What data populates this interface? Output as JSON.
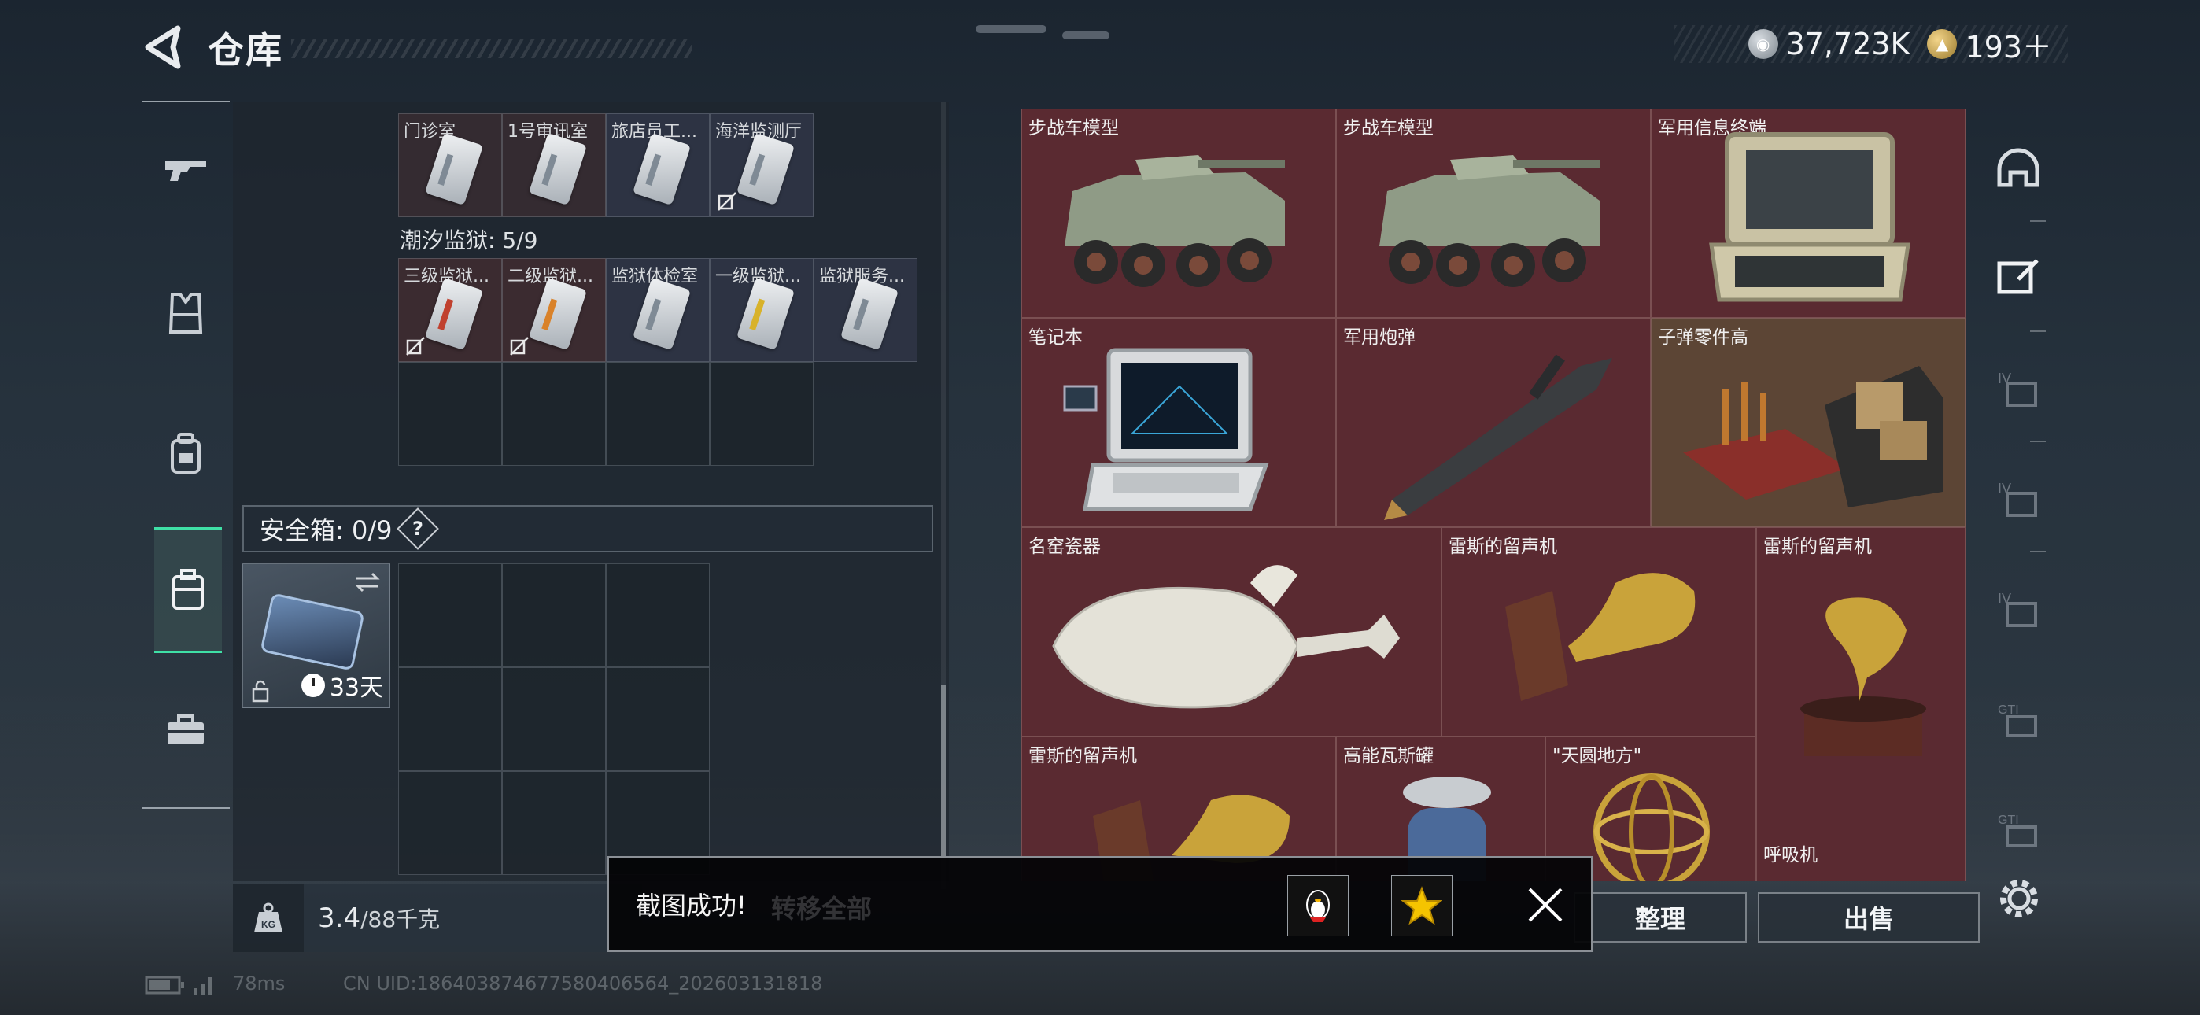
{
  "header": {
    "title": "仓库"
  },
  "currency": {
    "silver": "37,723K",
    "gold": "193＋"
  },
  "left_nav": [
    {
      "icon": "gun-icon"
    },
    {
      "icon": "vest-icon"
    },
    {
      "icon": "backpack-icon"
    },
    {
      "icon": "container-icon"
    },
    {
      "icon": "toolbox-icon"
    }
  ],
  "keycards_top": [
    "门诊室",
    "1号审讯室",
    "旅店员工...",
    "海洋监测厅"
  ],
  "tide_prison": {
    "label": "潮汐监狱: 5/9",
    "cards": [
      "三级监狱...",
      "二级监狱...",
      "监狱体检室",
      "一级监狱...",
      "监狱服务..."
    ]
  },
  "safe": {
    "label": "安全箱: 0/9",
    "help": "?",
    "days": "33天"
  },
  "weight": {
    "value": "3.4",
    "max": "/88千克"
  },
  "items": [
    {
      "label": "步战车模型"
    },
    {
      "label": "步战车模型"
    },
    {
      "label": "军用信息终端"
    },
    {
      "label": "笔记本"
    },
    {
      "label": "军用炮弹"
    },
    {
      "label": "子弹零件高"
    },
    {
      "label": "名窑瓷器"
    },
    {
      "label": "雷斯的留声机"
    },
    {
      "label": "雷斯的留声机"
    },
    {
      "label": "雷斯的留声机"
    },
    {
      "label": "高能瓦斯罐"
    },
    {
      "label": "\"天圆地方\""
    },
    {
      "label": "呼吸机"
    }
  ],
  "actions": {
    "sort": "整理",
    "sell": "出售",
    "transfer_ghost": "转移全部"
  },
  "toast": {
    "message": "截图成功!"
  },
  "footer": {
    "ping": "78ms",
    "uid": "CN UID:1864038746775804065​64_202603131818"
  },
  "colors": {
    "accent": "#3fe0a6",
    "item_bg": "#5a2a31"
  }
}
